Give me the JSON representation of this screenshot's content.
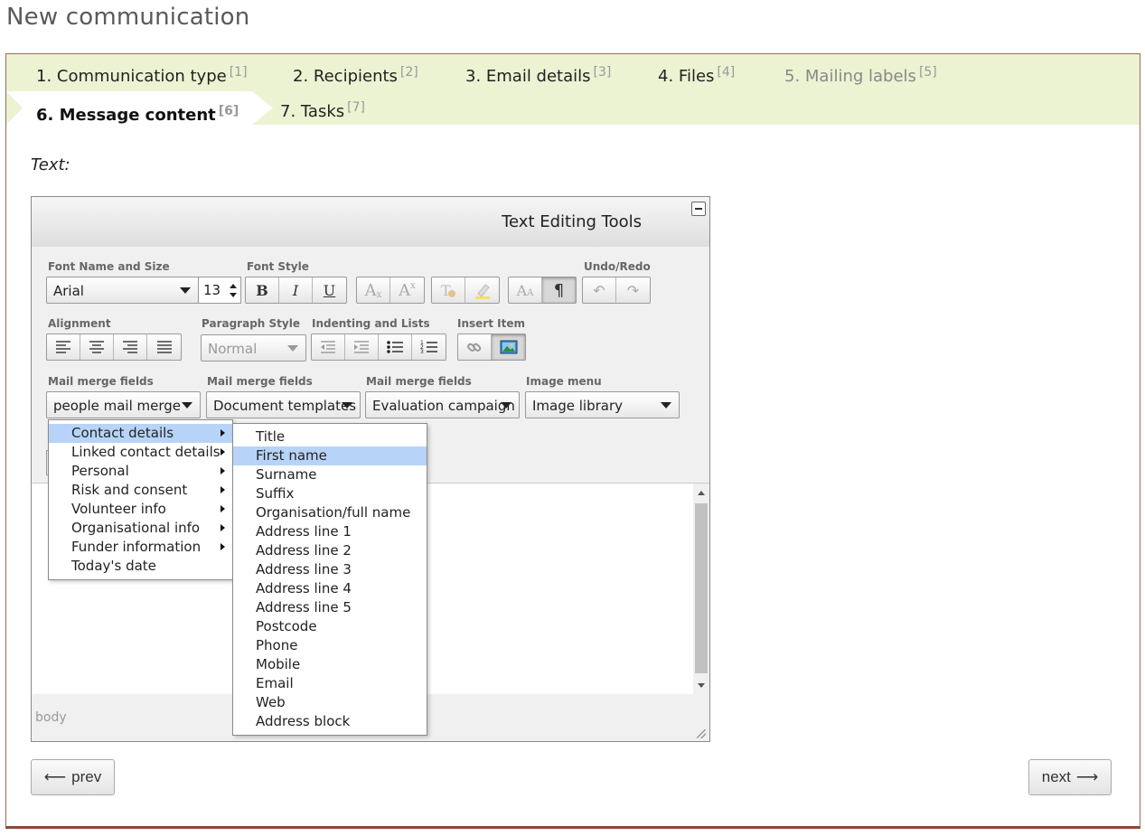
{
  "page": {
    "title": "New communication"
  },
  "tabs": [
    {
      "label": "1. Communication type",
      "num": "[1]"
    },
    {
      "label": "2. Recipients",
      "num": "[2]"
    },
    {
      "label": "3. Email details",
      "num": "[3]"
    },
    {
      "label": "4. Files",
      "num": "[4]"
    },
    {
      "label": "5. Mailing labels",
      "num": "[5]"
    },
    {
      "label": "6. Message content",
      "num": "[6]"
    },
    {
      "label": "7. Tasks",
      "num": "[7]"
    }
  ],
  "field_label": "Text:",
  "editor": {
    "title": "Text Editing Tools",
    "groups": {
      "font": "Font Name and Size",
      "style": "Font Style",
      "undo": "Undo/Redo",
      "align": "Alignment",
      "para": "Paragraph Style",
      "indent": "Indenting and Lists",
      "insert": "Insert Item",
      "merge1": "Mail merge fields",
      "merge2": "Mail merge fields",
      "merge3": "Mail merge fields",
      "image": "Image menu"
    },
    "font_name": "Arial",
    "font_size": "13",
    "paragraph_style": "Normal",
    "merge_selects": [
      "people mail merge",
      "Document templates",
      "Evaluation campaign",
      "Image library"
    ],
    "buttons": {
      "bold": "B",
      "italic": "I",
      "underline": "U",
      "subscript": "A",
      "superscript": "A",
      "pilcrow": "¶"
    },
    "path": "body"
  },
  "menu_main": [
    {
      "label": "Contact details",
      "sub": true,
      "highlighted": true
    },
    {
      "label": "Linked contact details",
      "sub": true
    },
    {
      "label": "Personal",
      "sub": true
    },
    {
      "label": "Risk and consent",
      "sub": true
    },
    {
      "label": "Volunteer info",
      "sub": true
    },
    {
      "label": "Organisational info",
      "sub": true
    },
    {
      "label": "Funder information",
      "sub": true
    },
    {
      "label": "Today's date",
      "sub": false
    }
  ],
  "menu_sub": [
    "Title",
    "First name",
    "Surname",
    "Suffix",
    "Organisation/full name",
    "Address line 1",
    "Address line 2",
    "Address line 3",
    "Address line 4",
    "Address line 5",
    "Postcode",
    "Phone",
    "Mobile",
    "Email",
    "Web",
    "Address block"
  ],
  "menu_sub_highlight": "First name",
  "nav": {
    "prev": "prev",
    "next": "next",
    "prev_arrow": "⟵",
    "next_arrow": "⟶"
  }
}
